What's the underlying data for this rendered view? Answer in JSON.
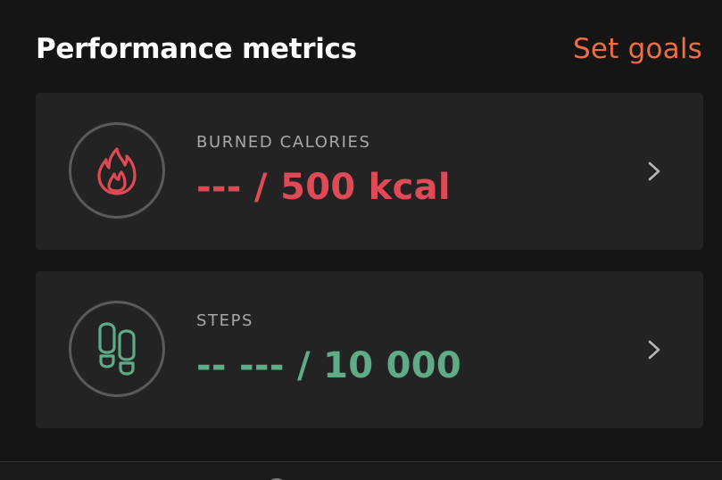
{
  "header": {
    "title": "Performance metrics",
    "action_label": "Set goals"
  },
  "metrics": [
    {
      "label": "BURNED CALORIES",
      "value": "--- / 500 kcal",
      "icon": "flame-icon",
      "color": "#de4a55"
    },
    {
      "label": "STEPS",
      "value": "-- --- / 10 000",
      "icon": "footprints-icon",
      "color": "#5fab86"
    }
  ],
  "colors": {
    "background": "#151515",
    "card": "#232323",
    "accent": "#ee6d46",
    "label": "#a8a8a8"
  }
}
